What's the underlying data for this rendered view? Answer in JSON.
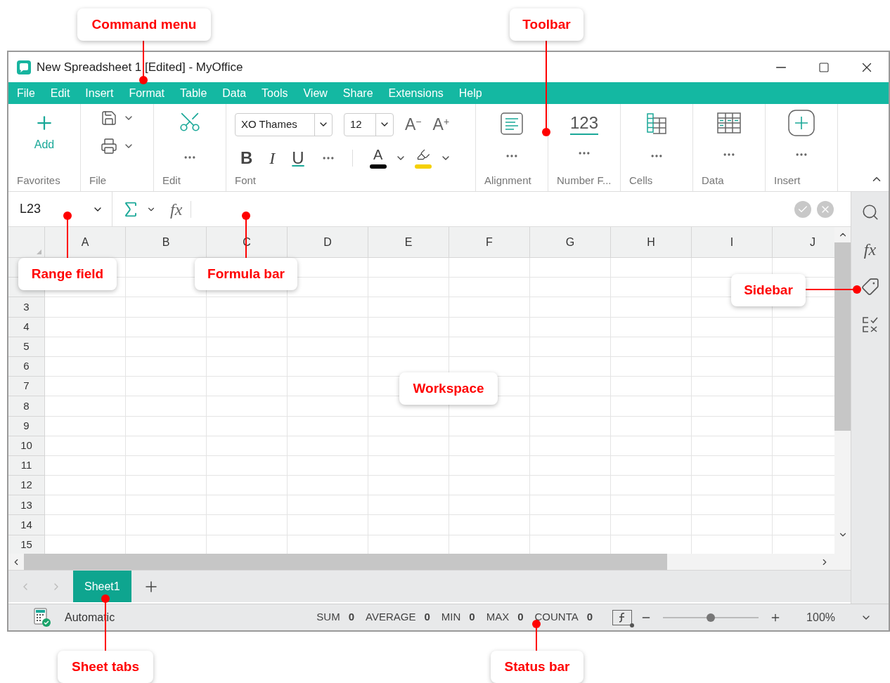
{
  "window": {
    "title": "New Spreadsheet 1 [Edited] - MyOffice"
  },
  "menu": [
    "File",
    "Edit",
    "Insert",
    "Format",
    "Table",
    "Data",
    "Tools",
    "View",
    "Share",
    "Extensions",
    "Help"
  ],
  "ribbon": {
    "groups": [
      {
        "kind": "favorites",
        "label": "Favorites",
        "button": "Add"
      },
      {
        "kind": "file",
        "label": "File"
      },
      {
        "kind": "edit",
        "label": "Edit"
      },
      {
        "kind": "font",
        "label": "Font",
        "font": "XO Thames",
        "size": "12",
        "size_buttons": [
          "A$^{−}$",
          "A$^{+}$"
        ],
        "styles": [
          "B",
          "I",
          "U"
        ],
        "color_button": "A"
      },
      {
        "kind": "alignment",
        "label": "Alignment"
      },
      {
        "kind": "number",
        "label": "Number F...",
        "sample": "123"
      },
      {
        "kind": "cells",
        "label": "Cells"
      },
      {
        "kind": "data",
        "label": "Data"
      },
      {
        "kind": "insert",
        "label": "Insert"
      }
    ]
  },
  "formula_bar": {
    "range": "L23",
    "function_icon": "fx"
  },
  "columns": [
    "A",
    "B",
    "C",
    "D",
    "E",
    "F",
    "G",
    "H",
    "I",
    "J"
  ],
  "rows": [
    "3",
    "4",
    "5",
    "6",
    "7",
    "8",
    "9",
    "10",
    "11",
    "12",
    "13",
    "14",
    "15"
  ],
  "sidebar": {
    "function_icon": "fx"
  },
  "sheet_tabs": [
    {
      "label": "Sheet1",
      "selected": true
    }
  ],
  "status_bar": {
    "mode": "Automatic",
    "stats": [
      {
        "label": "SUM",
        "value": "0"
      },
      {
        "label": "AVERAGE",
        "value": "0"
      },
      {
        "label": "MIN",
        "value": "0"
      },
      {
        "label": "MAX",
        "value": "0"
      },
      {
        "label": "COUNTA",
        "value": "0"
      }
    ],
    "zoom": {
      "level": 0.5,
      "reading": "100%"
    }
  },
  "callouts": [
    {
      "text": "Command menu"
    },
    {
      "text": "Toolbar"
    },
    {
      "text": "Range field"
    },
    {
      "text": "Formula bar"
    },
    {
      "text": "Sidebar"
    },
    {
      "text": "Workspace"
    },
    {
      "text": "Sheet tabs"
    },
    {
      "text": "Status bar"
    }
  ]
}
